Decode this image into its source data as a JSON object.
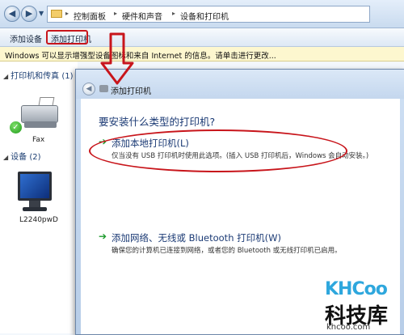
{
  "address_bar": {
    "breadcrumbs": [
      "控制面板",
      "硬件和声音",
      "设备和打印机"
    ]
  },
  "command_bar": {
    "add_device": "添加设备",
    "add_printer": "添加打印机"
  },
  "info_bar": {
    "text": "Windows 可以显示增强型设备图标和来自 Internet 的信息。请单击进行更改..."
  },
  "left_pane": {
    "printers_group": "打印机和传真 (1)",
    "printer_device": "Fax",
    "devices_group": "设备 (2)",
    "monitor_device": "L2240pwD"
  },
  "dialog": {
    "title": "添加打印机",
    "question": "要安装什么类型的打印机?",
    "options": [
      {
        "title": "添加本地打印机(L)",
        "desc": "仅当没有 USB 打印机时使用此选项。(插入 USB 打印机后，Windows 会自动安装。)"
      },
      {
        "title": "添加网络、无线或 Bluetooth 打印机(W)",
        "desc": "确保您的计算机已连接到网络，或者您的 Bluetooth 或无线打印机已启用。"
      }
    ]
  },
  "watermark": {
    "logo_prefix": "KH",
    "logo_suffix": "Coo",
    "name": "科技库",
    "url": "khcoo.com"
  },
  "colors": {
    "highlight_red": "#c8151b",
    "link_blue": "#1c3b75",
    "arrow_green": "#1c9a2c",
    "watermark_blue": "#2ea7dd"
  }
}
